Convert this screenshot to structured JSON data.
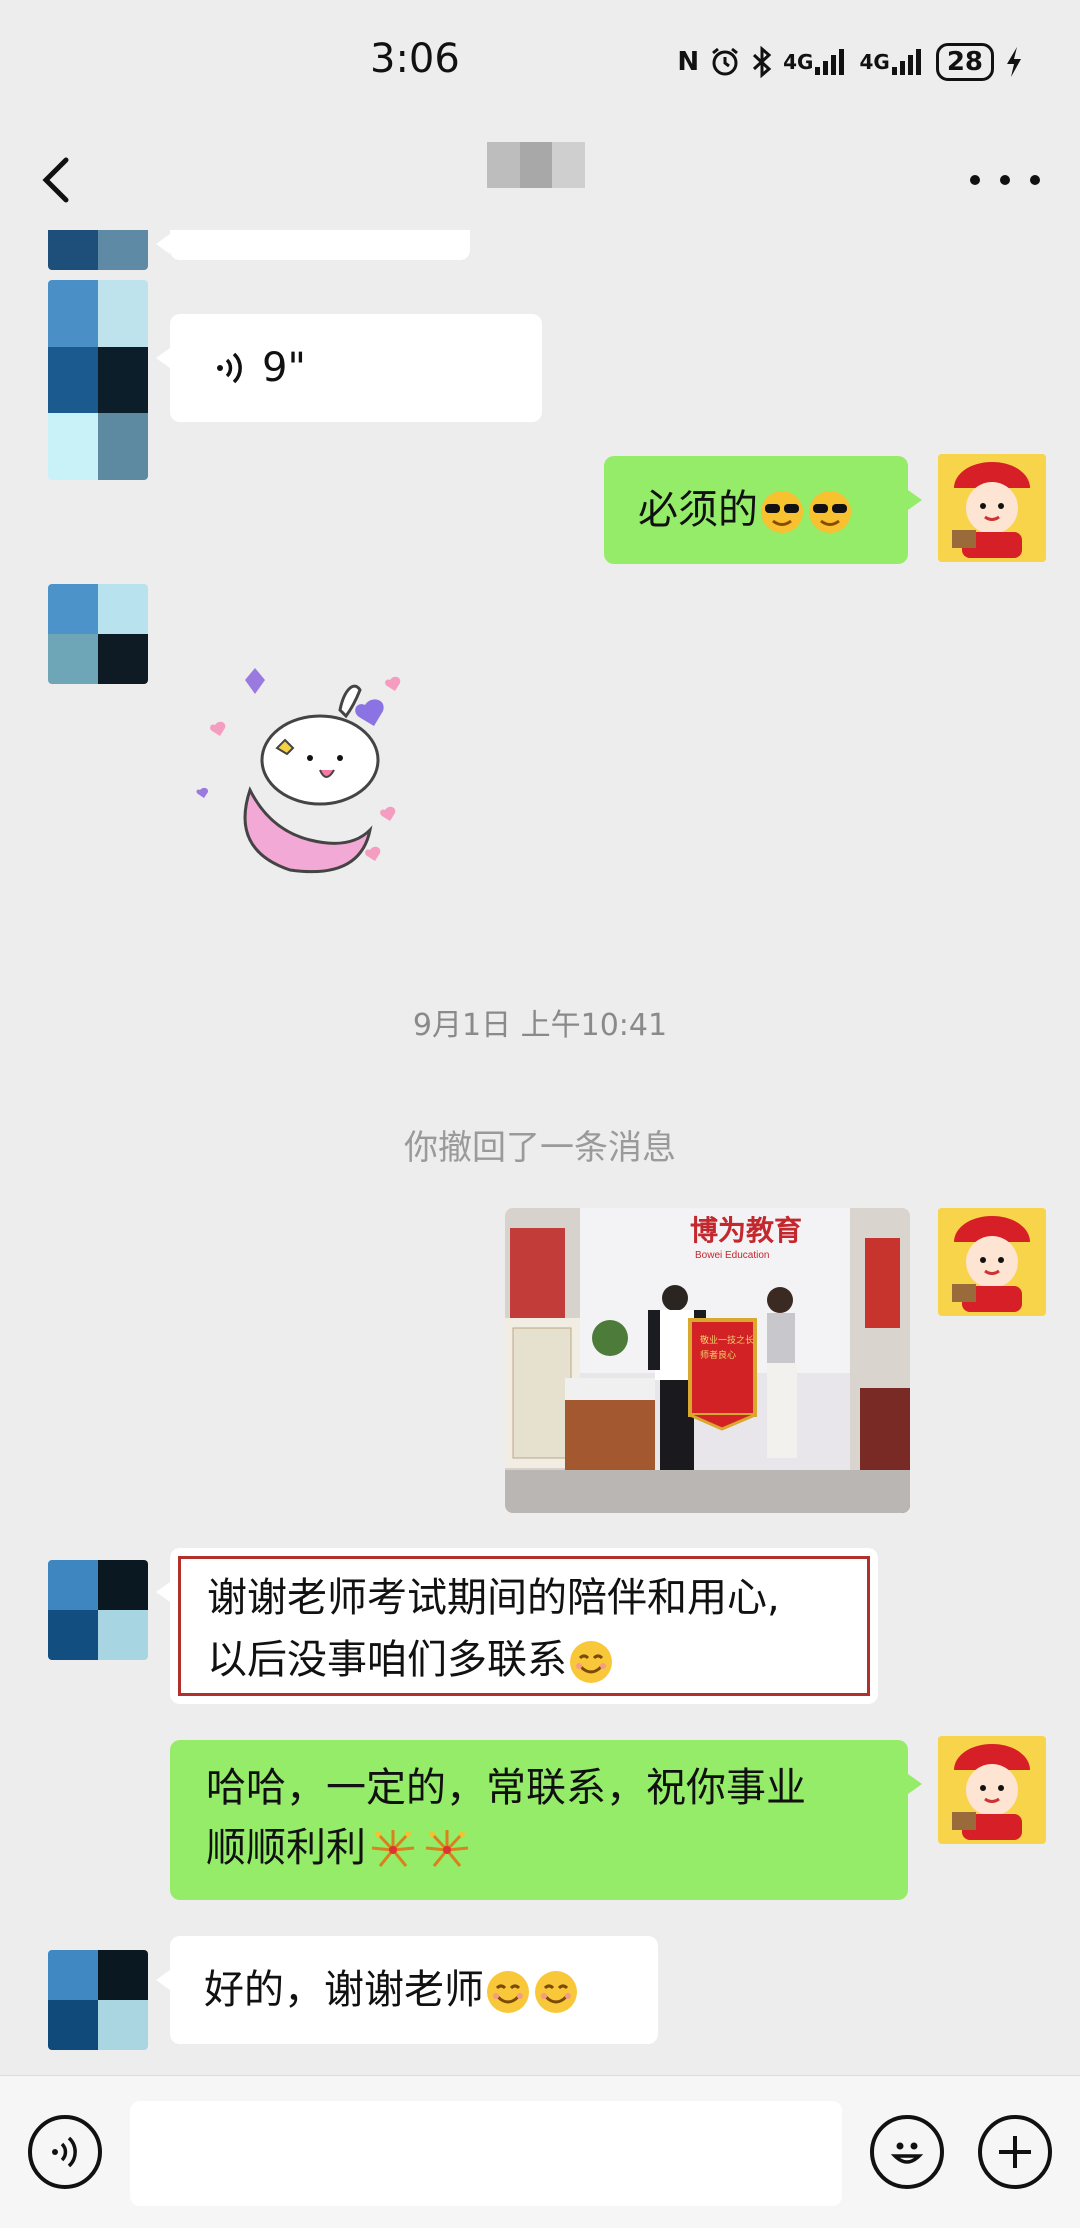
{
  "status_bar": {
    "time": "3:06",
    "nfc_label": "N",
    "network1_label": "4G",
    "network2_label": "4G",
    "battery": "28"
  },
  "nav": {
    "back_icon": "chevron-left-icon",
    "more_icon": "more-dots-icon"
  },
  "messages": {
    "voice": {
      "duration": "9\""
    },
    "out1": {
      "text": "必须的",
      "emoji": [
        "sunglasses-emoji",
        "sunglasses-emoji"
      ]
    },
    "timestamp": "9月1日 上午10:41",
    "recall_notice": "你撤回了一条消息",
    "in2": {
      "line1": "谢谢老师考试期间的陪伴和用心,",
      "line2": "以后没事咱们多联系",
      "emoji": "smile-emoji"
    },
    "out3": {
      "line1": "哈哈，一定的，常联系，祝你事业",
      "line2": "顺顺利利",
      "emoji": [
        "fireworks-emoji",
        "fireworks-emoji"
      ]
    },
    "in3": {
      "text": "好的，谢谢老师",
      "emoji": [
        "smile-emoji",
        "smile-emoji"
      ]
    }
  },
  "photo": {
    "sign_text": "博为教育",
    "sign_subtext": "Bowei Education",
    "banner_line1": "敬业一技之长",
    "banner_line2": "师者良心"
  },
  "input_bar": {
    "voice_icon": "voice-input-icon",
    "emoji_icon": "emoji-icon",
    "plus_icon": "plus-icon"
  },
  "colors": {
    "background": "#ededed",
    "bubble_out": "#95ec69",
    "bubble_in": "#ffffff",
    "timestamp_text": "#8a8a8a"
  }
}
